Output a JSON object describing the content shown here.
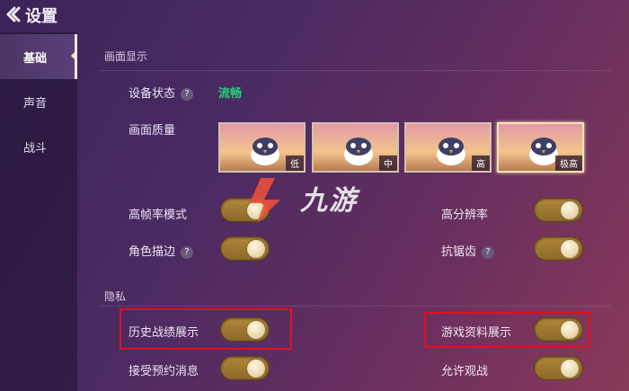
{
  "header": {
    "title": "设置"
  },
  "sidebar": {
    "items": [
      {
        "label": "基础",
        "active": true
      },
      {
        "label": "声音",
        "active": false
      },
      {
        "label": "战斗",
        "active": false
      }
    ]
  },
  "display": {
    "section_title": "画面显示",
    "device_status_label": "设备状态",
    "device_status_value": "流畅",
    "quality_label": "画面质量",
    "quality_options": [
      "低",
      "中",
      "高",
      "极高"
    ],
    "quality_selected": "极高",
    "toggles": {
      "high_framerate": "高帧率模式",
      "high_resolution": "高分辨率",
      "outline": "角色描边",
      "antialias": "抗锯齿"
    }
  },
  "privacy": {
    "section_title": "隐私",
    "history_label": "历史战绩展示",
    "profile_label": "游戏资料展示",
    "invite_label": "接受预约消息",
    "spectate_label": "允许观战"
  },
  "watermark": {
    "text": "九游"
  },
  "colors": {
    "status_green": "#27d37b",
    "highlight_red": "#e01020",
    "toggle_gold": "#b0863a"
  },
  "toggle_states": {
    "all_on": true
  }
}
